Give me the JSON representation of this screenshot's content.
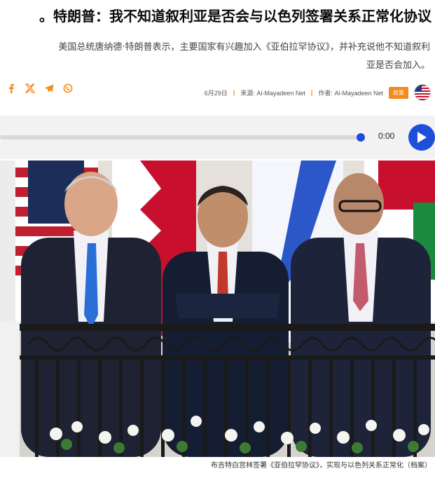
{
  "article": {
    "title": "。特朗普：我不知道叙利亚是否会与以色列签署关系正常化协议",
    "lede_line1": "美国总统唐纳德·特朗普表示，主要国家有兴趣加入《亚伯拉罕协议》，并补充说他不知道叙利",
    "lede_line2": "。亚是否会加入",
    "date": "6月29日",
    "source_label": "来源:",
    "source": "Al-Mayadeen Net",
    "author_label": "作者:",
    "author": "Al-Mayadeen Net",
    "category": "政策",
    "caption": "布吉特白宫林签署《亚伯拉罕协议》，实现与以色列关系正常化（档案）"
  },
  "share": {
    "icons": [
      "facebook-icon",
      "x-icon",
      "telegram-icon",
      "whatsapp-icon"
    ],
    "accent": "#f58a1f"
  },
  "player": {
    "time": "0:00",
    "progress": 1.0,
    "accent": "#1f4fd8"
  }
}
